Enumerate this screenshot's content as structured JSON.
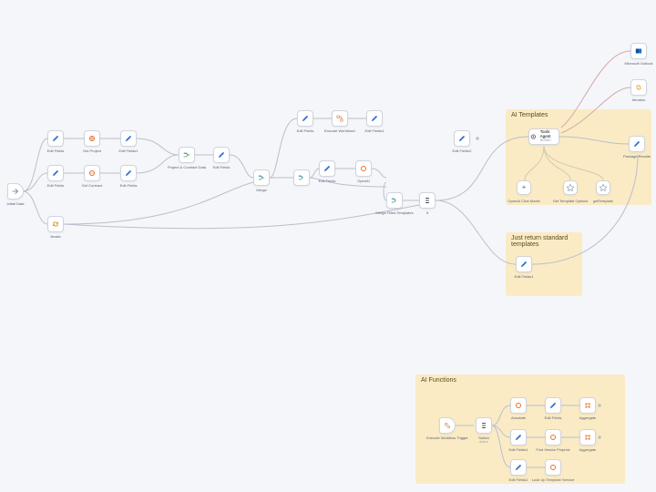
{
  "groups": {
    "ai_templates": {
      "title": "AI Templates"
    },
    "just_return": {
      "title": "Just return standard templates"
    },
    "ai_functions": {
      "title": "AI Functions"
    }
  },
  "nodes": {
    "initial": {
      "label": "Initial Data"
    },
    "ef1": {
      "label": "Edit Fields"
    },
    "ef2": {
      "label": "Edit Fields"
    },
    "ef3": {
      "label": "Edit Fields1"
    },
    "gp": {
      "label": "Get Project"
    },
    "gc": {
      "label": "Get Contract"
    },
    "pce": {
      "label": "Project & Contract Data"
    },
    "ef4": {
      "label": "Edit Fields"
    },
    "merge": {
      "label": "Merge"
    },
    "iter": {
      "label": "Iterate"
    },
    "ef5": {
      "label": "Edit Fields"
    },
    "ef6": {
      "label": "Edit Fields "
    },
    "ef7": {
      "label": "Edit Fields"
    },
    "oai": {
      "label": "OpenAI"
    },
    "exw": {
      "label": "Execute Workflow1"
    },
    "ef8": {
      "label": "Edit Fields1"
    },
    "ef9": {
      "label": "Edit Fields"
    },
    "ef10": {
      "label": "Edit Fields2"
    },
    "oai2": {
      "label": "OpenAI"
    },
    "exb": {
      "label": "Execute Workflow"
    },
    "mft": {
      "label": "Merge Filled Templates"
    },
    "if": {
      "label": "If"
    },
    "agent": {
      "label": "Tools Agent",
      "sub": "action"
    },
    "pkg": {
      "label": "Package Results"
    },
    "chat": {
      "label": "OpenAI Chat Model"
    },
    "gto": {
      "label": "Get Template Options"
    },
    "gtm": {
      "label": "getTemplate"
    },
    "outlook": {
      "label": "Microsoft Outlook"
    },
    "wait": {
      "label": "Iteration"
    },
    "jret": {
      "label": "Edit Fields1"
    },
    "ewt": {
      "label": "Execute Workflow Trigger"
    },
    "switch": {
      "label": "Switch",
      "sub": "Action"
    },
    "ann": {
      "label": "Annotate"
    },
    "ef11": {
      "label": "Edit Fields"
    },
    "agg1": {
      "label": "Aggregate"
    },
    "ef12": {
      "label": "Edit Fields1"
    },
    "fvp": {
      "label": "Find Vendor Projects"
    },
    "agg2": {
      "label": "Aggregate"
    },
    "ef13": {
      "label": "Edit Fields2"
    },
    "luts": {
      "label": "Look Up Template Service"
    }
  },
  "colors": {
    "accent_blue": "#2f6fd6",
    "accent_orange": "#e86a24",
    "muted": "#8a93a4"
  }
}
